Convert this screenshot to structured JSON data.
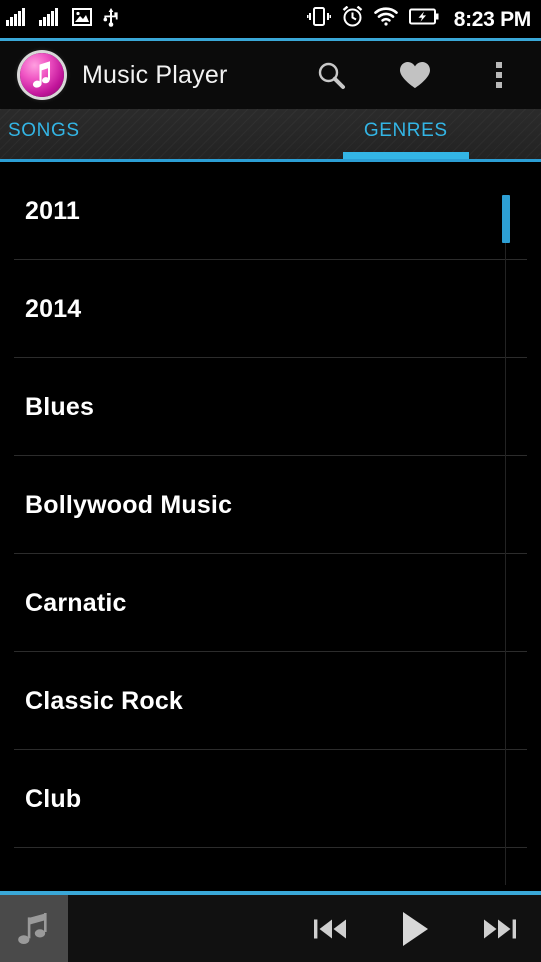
{
  "status_bar": {
    "icons": [
      {
        "name": "signal-bars-icon-1",
        "label": "signal-bars"
      },
      {
        "name": "signal-bars-icon-2",
        "label": "signal-bars"
      },
      {
        "name": "image-icon",
        "label": "screenshot"
      },
      {
        "name": "usb-icon",
        "label": "usb"
      }
    ],
    "right_icons": [
      {
        "name": "vibrate-icon",
        "label": "vibrate"
      },
      {
        "name": "alarm-clock-icon",
        "label": "alarm"
      },
      {
        "name": "wifi-icon",
        "label": "wifi"
      },
      {
        "name": "battery-charging-icon",
        "label": "battery charging"
      }
    ],
    "time": "8:23 PM"
  },
  "action_bar": {
    "title": "Music Player",
    "logo_name": "music-note-logo",
    "actions": [
      {
        "name": "search-icon",
        "label": "Search"
      },
      {
        "name": "heart-icon",
        "label": "Favorites"
      },
      {
        "name": "overflow-menu-icon",
        "label": "More options"
      }
    ]
  },
  "tabs": {
    "items": [
      {
        "label": "SONGS",
        "selected": false
      },
      {
        "label": "GENRES",
        "selected": true
      }
    ],
    "accent_color": "#33b5e5"
  },
  "list": {
    "items": [
      {
        "label": "2011"
      },
      {
        "label": "2014"
      },
      {
        "label": "Blues"
      },
      {
        "label": "Bollywood Music"
      },
      {
        "label": "Carnatic"
      },
      {
        "label": "Classic Rock"
      },
      {
        "label": "Club"
      }
    ],
    "scrollbar_color": "#2d9fd4"
  },
  "player": {
    "album_art_name": "album-art-placeholder",
    "controls": [
      {
        "name": "previous-button",
        "label": "Previous"
      },
      {
        "name": "play-button",
        "label": "Play"
      },
      {
        "name": "next-button",
        "label": "Next"
      }
    ]
  },
  "colors": {
    "accent": "#33b5e5",
    "background": "#000000",
    "text": "#ffffff"
  }
}
